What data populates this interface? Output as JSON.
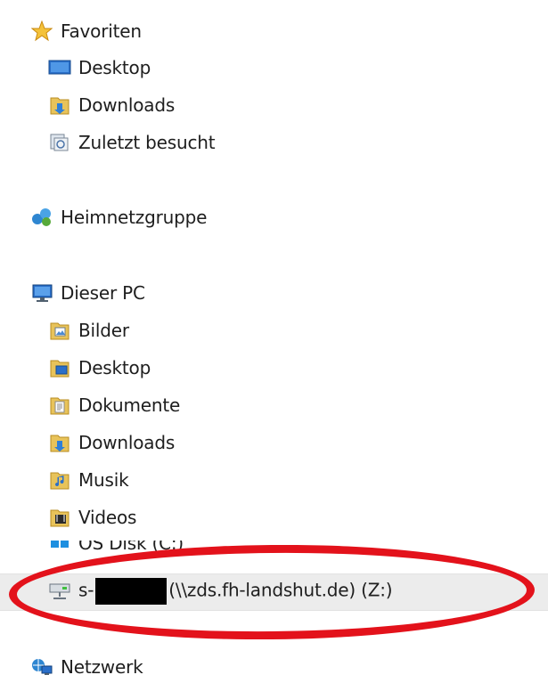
{
  "favorites": {
    "header": "Favoriten",
    "items": [
      {
        "label": "Desktop",
        "icon": "desktop-icon"
      },
      {
        "label": "Downloads",
        "icon": "downloads-folder-icon"
      },
      {
        "label": "Zuletzt besucht",
        "icon": "recent-places-icon"
      }
    ]
  },
  "homegroup": {
    "label": "Heimnetzgruppe",
    "icon": "homegroup-icon"
  },
  "this_pc": {
    "header": "Dieser PC",
    "items": [
      {
        "label": "Bilder",
        "icon": "pictures-folder-icon"
      },
      {
        "label": "Desktop",
        "icon": "desktop-folder-icon"
      },
      {
        "label": "Dokumente",
        "icon": "documents-folder-icon"
      },
      {
        "label": "Downloads",
        "icon": "downloads-folder-icon"
      },
      {
        "label": "Musik",
        "icon": "music-folder-icon"
      },
      {
        "label": "Videos",
        "icon": "videos-folder-icon"
      },
      {
        "label": "OS Disk (C:)",
        "icon": "drive-icon"
      }
    ],
    "network_drive": {
      "prefix": "s-",
      "suffix": "(\\\\zds.fh-landshut.de) (Z:)",
      "icon": "network-drive-icon"
    }
  },
  "network": {
    "label": "Netzwerk",
    "icon": "network-icon"
  },
  "colors": {
    "highlight": "#e3121b",
    "folder": "#e8c35a",
    "selection": "#ececec"
  }
}
